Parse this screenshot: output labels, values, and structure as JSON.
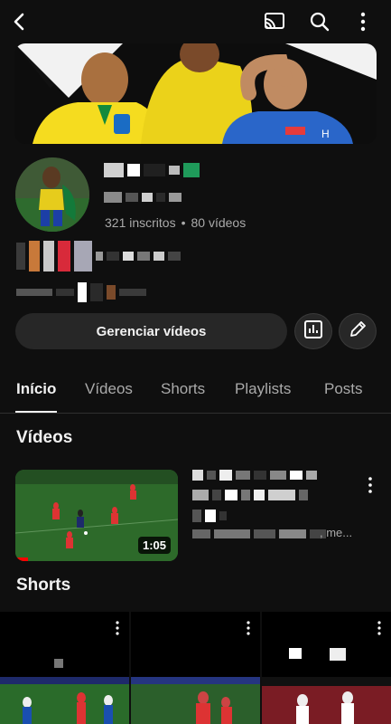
{
  "header": {
    "back_icon": "arrow-back-icon",
    "cast_icon": "cast-icon",
    "search_icon": "search-icon",
    "more_icon": "more-vert-icon"
  },
  "channel": {
    "subscribers": "321 inscritos",
    "separator": "•",
    "videos_count": "80 vídeos"
  },
  "actions": {
    "manage_label": "Gerenciar vídeos",
    "analytics_icon": "analytics-icon",
    "edit_icon": "pencil-icon"
  },
  "tabs": [
    {
      "label": "Início",
      "active": true
    },
    {
      "label": "Vídeos",
      "active": false
    },
    {
      "label": "Shorts",
      "active": false
    },
    {
      "label": "Playlists",
      "active": false
    },
    {
      "label": "Posts",
      "active": false
    }
  ],
  "videos_section": {
    "title": "Vídeos",
    "item": {
      "duration": "1:05",
      "meta_suffix": ", me...",
      "watched_fraction": 0.08
    }
  },
  "shorts_section": {
    "title": "Shorts"
  },
  "colors": {
    "background": "#0f0f0f",
    "button": "#272727",
    "text_secondary": "#aaaaaa",
    "progress": "#ff0000"
  }
}
